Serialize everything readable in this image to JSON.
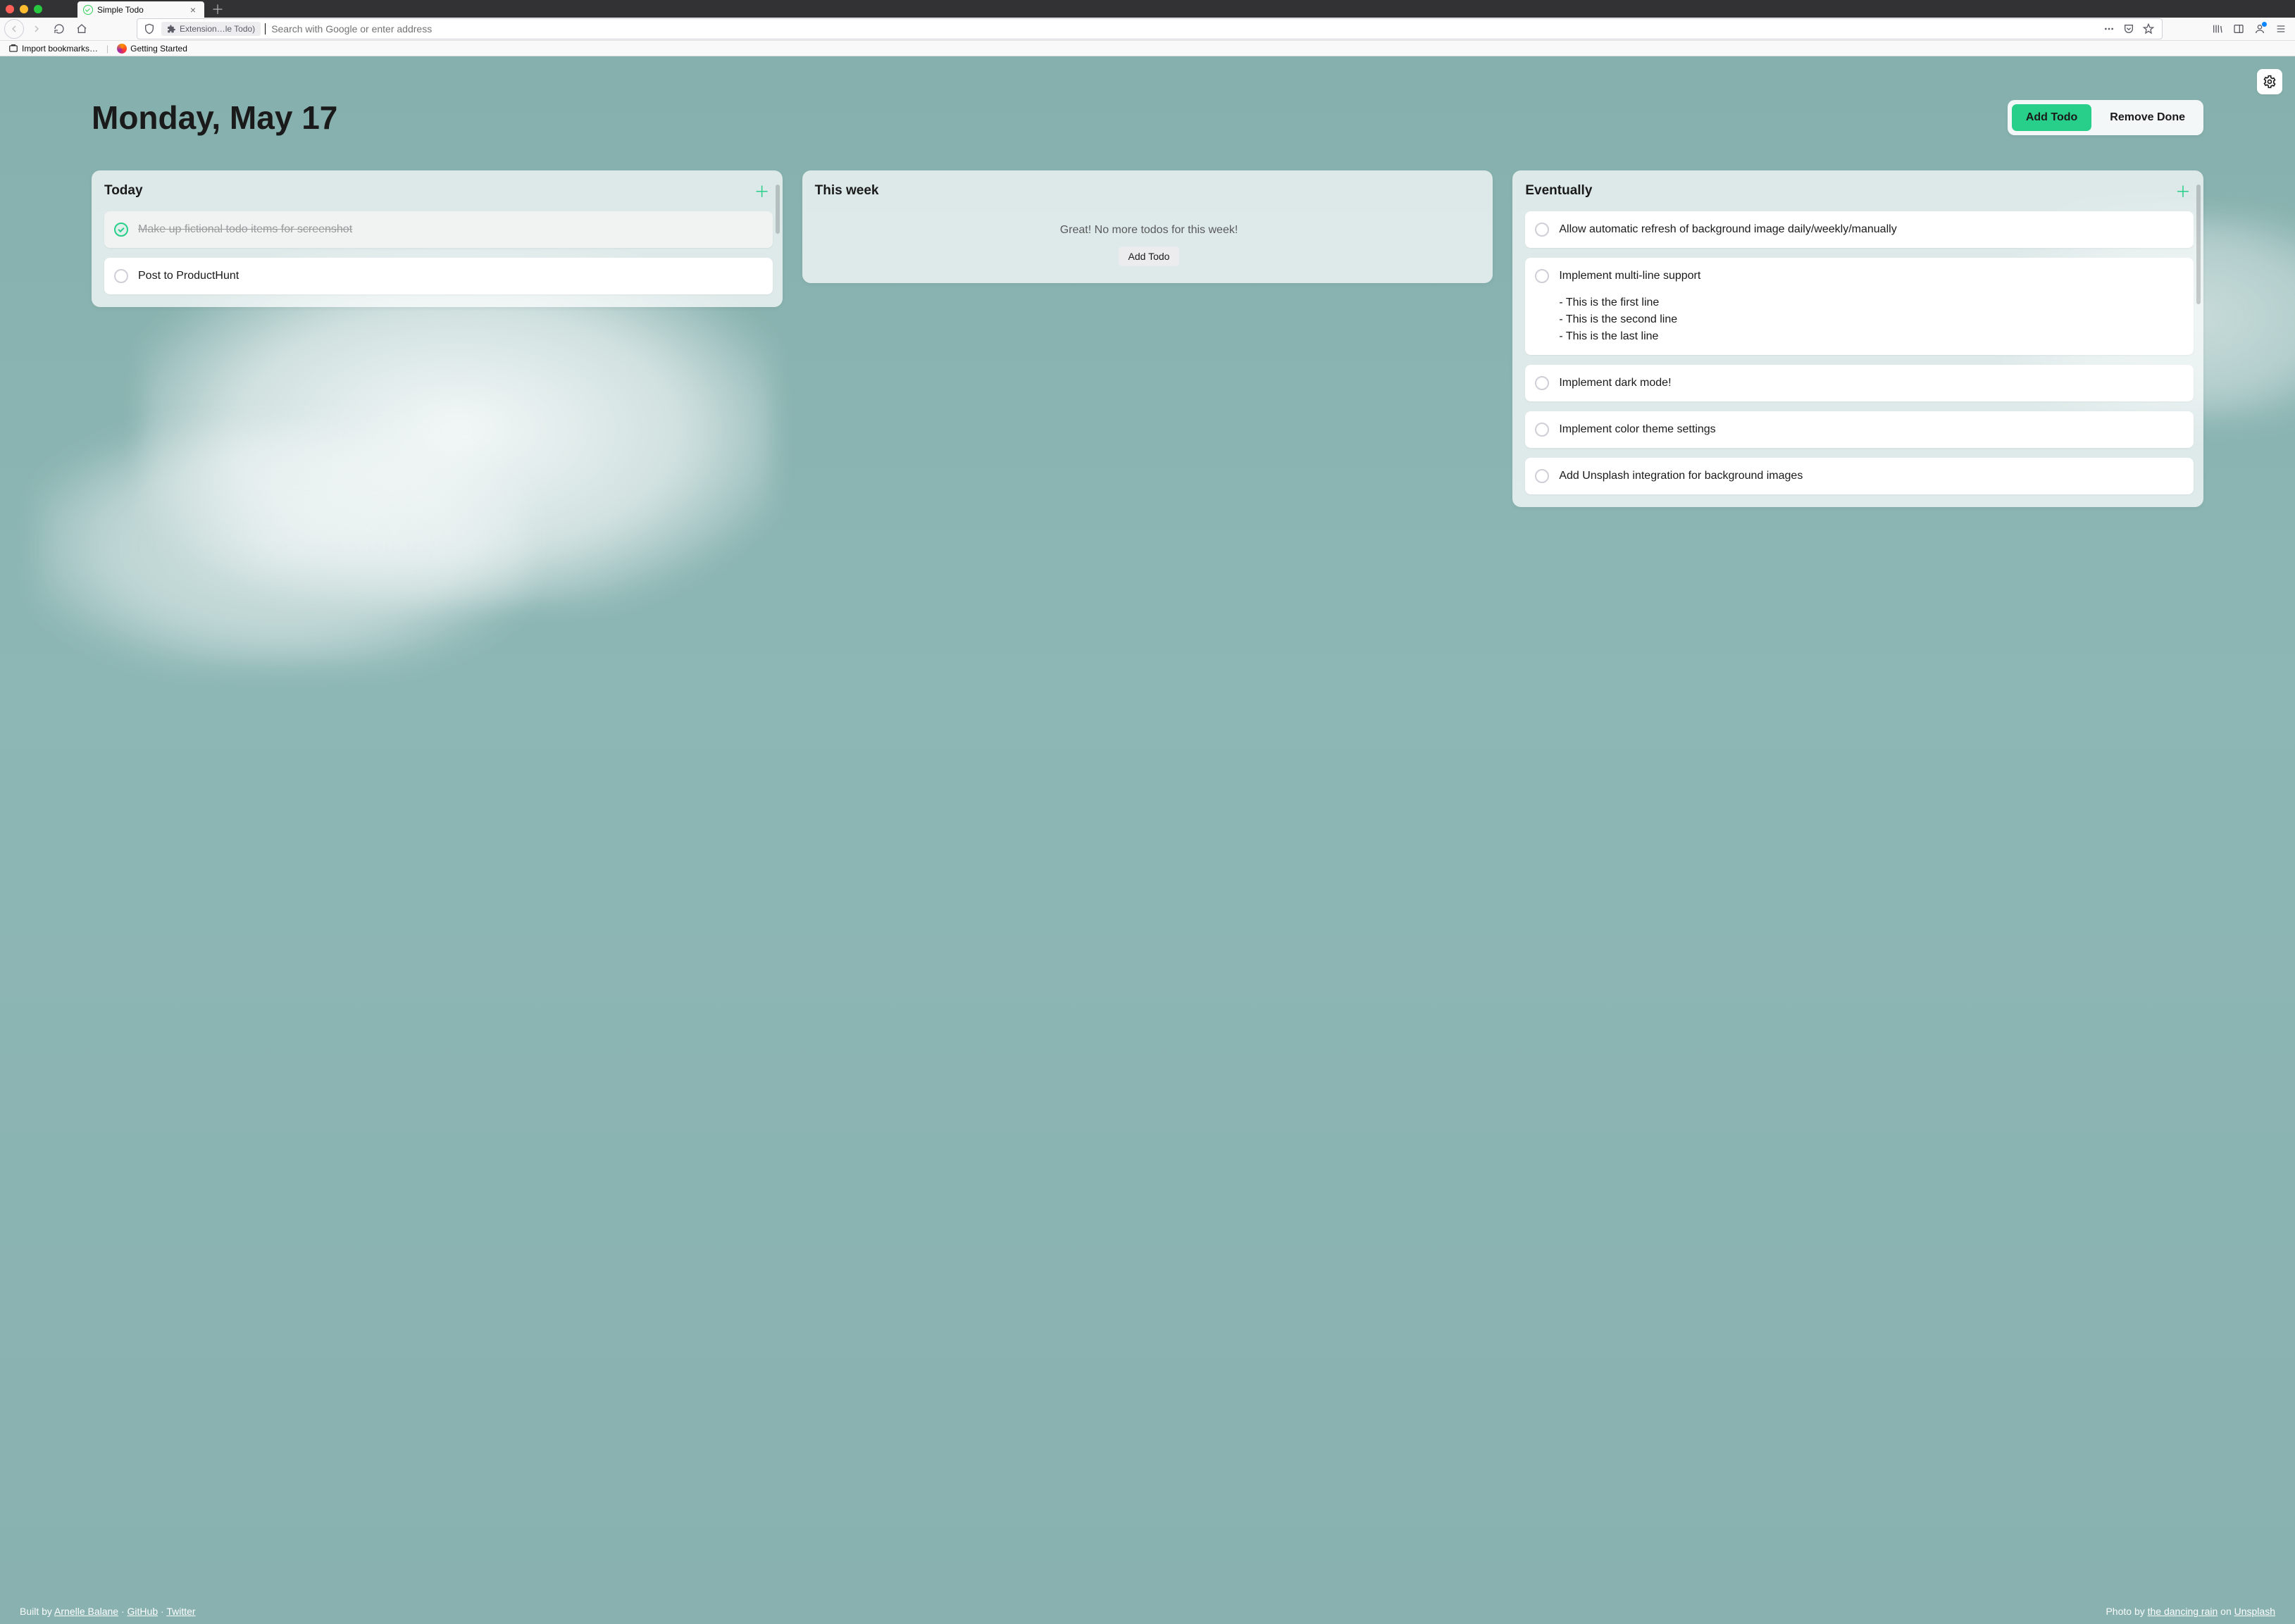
{
  "browser": {
    "tab_title": "Simple Todo",
    "url_chip": "Extension…le Todo)",
    "url_placeholder": "Search with Google or enter address",
    "bookmarks": {
      "import": "Import bookmarks…",
      "getting_started": "Getting Started"
    }
  },
  "app": {
    "date": "Monday, May 17",
    "add_todo_btn": "Add Todo",
    "remove_done_btn": "Remove Done",
    "columns": {
      "today": {
        "title": "Today",
        "items": [
          {
            "done": true,
            "text": "Make up fictional todo items for screenshot"
          },
          {
            "done": false,
            "text": "Post to ProductHunt"
          }
        ]
      },
      "this_week": {
        "title": "This week",
        "empty_text": "Great! No more todos for this week!",
        "add_btn": "Add Todo"
      },
      "eventually": {
        "title": "Eventually",
        "items": [
          {
            "done": false,
            "text": "Allow automatic refresh of background image daily/weekly/manually"
          },
          {
            "done": false,
            "text": "Implement multi-line support",
            "sub": "- This is the first line\n- This is the second line\n- This is the last line"
          },
          {
            "done": false,
            "text": "Implement dark mode!"
          },
          {
            "done": false,
            "text": "Implement color theme settings"
          },
          {
            "done": false,
            "text": "Add Unsplash integration for background images"
          }
        ]
      }
    },
    "footer": {
      "built_by": "Built by ",
      "author": "Arnelle Balane",
      "sep": " · ",
      "github": "GitHub",
      "twitter": "Twitter",
      "photo_by": "Photo by ",
      "photographer": "the dancing rain",
      "on": " on ",
      "unsplash": "Unsplash"
    }
  },
  "colors": {
    "accent": "#28cf8a"
  }
}
